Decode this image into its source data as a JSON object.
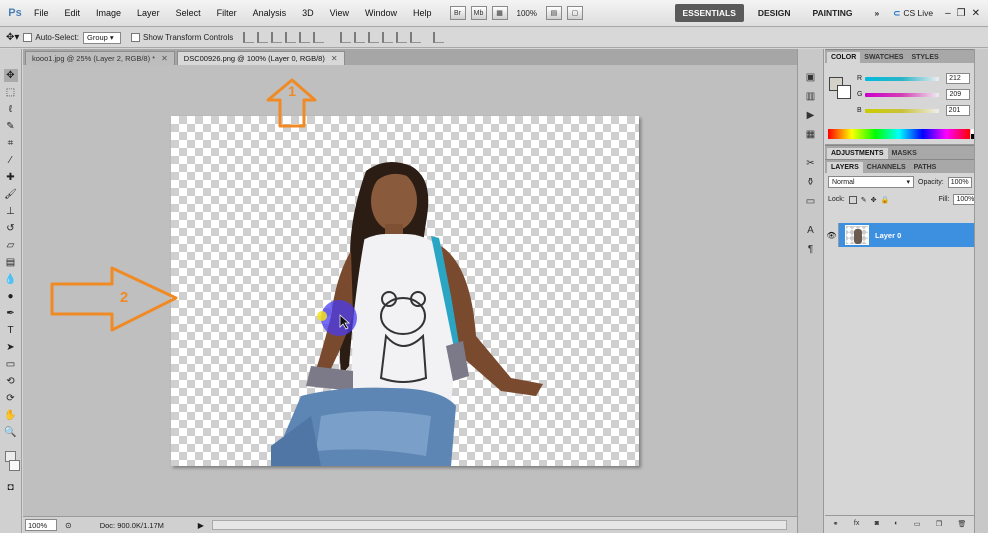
{
  "app": {
    "logo": "Ps"
  },
  "menu": [
    "File",
    "Edit",
    "Image",
    "Layer",
    "Select",
    "Filter",
    "Analysis",
    "3D",
    "View",
    "Window",
    "Help"
  ],
  "menu_tools": {
    "zoom": "100%"
  },
  "workspaces": [
    "ESSENTIALS",
    "DESIGN",
    "PAINTING"
  ],
  "workspace_more": "»",
  "cslive": "CS Live",
  "options": {
    "auto_select_label": "Auto-Select:",
    "auto_select_value": "Group",
    "transform_label": "Show Transform Controls"
  },
  "tabs": [
    {
      "label": "kooo1.jpg @ 25% (Layer 2, RGB/8) *",
      "active": false
    },
    {
      "label": "DSC00926.png @ 100% (Layer 0, RGB/8)",
      "active": true
    }
  ],
  "status": {
    "zoom": "100%",
    "doc": "Doc: 900.0K/1.17M"
  },
  "annotations": {
    "arrow1": "1",
    "arrow2": "2"
  },
  "color_panel": {
    "tabs": [
      "COLOR",
      "SWATCHES",
      "STYLES"
    ],
    "channels": [
      {
        "label": "R",
        "value": "212",
        "color": "#2ab4c8"
      },
      {
        "label": "G",
        "value": "209",
        "color": "#d43fb5"
      },
      {
        "label": "B",
        "value": "201",
        "color": "#c9c23a"
      }
    ]
  },
  "adjustments": {
    "tabs": [
      "ADJUSTMENTS",
      "MASKS"
    ]
  },
  "layers": {
    "tabs": [
      "LAYERS",
      "CHANNELS",
      "PATHS"
    ],
    "blend_mode": "Normal",
    "opacity_label": "Opacity:",
    "opacity": "100%",
    "lock_label": "Lock:",
    "fill_label": "Fill:",
    "fill": "100%",
    "items": [
      {
        "name": "Layer 0"
      }
    ]
  }
}
